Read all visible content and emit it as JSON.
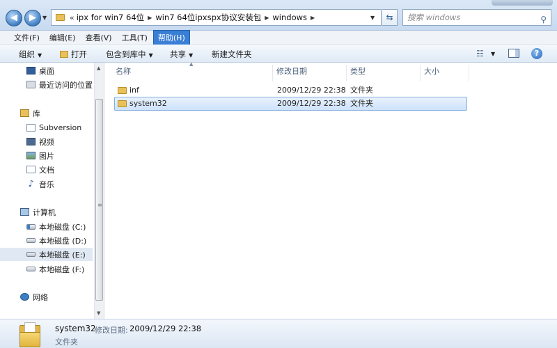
{
  "address": {
    "breadcrumbs": [
      "ipx for win7 64位",
      "win7 64位ipxspx协议安装包",
      "windows"
    ],
    "prefix": "«",
    "search_placeholder": "搜索 windows"
  },
  "menu": {
    "items": [
      "文件(F)",
      "编辑(E)",
      "查看(V)",
      "工具(T)",
      "帮助(H)"
    ],
    "active_index": 4
  },
  "toolbar": {
    "organize": "组织",
    "open": "打开",
    "include_in_library": "包含到库中",
    "share": "共享",
    "new_folder": "新建文件夹"
  },
  "nav": {
    "favorites": [
      {
        "label": "桌面",
        "icon": "desktop-icon"
      },
      {
        "label": "最近访问的位置",
        "icon": "recent-places-icon"
      }
    ],
    "libraries_label": "库",
    "libraries": [
      {
        "label": "Subversion",
        "icon": "document-library-icon"
      },
      {
        "label": "视频",
        "icon": "video-icon"
      },
      {
        "label": "图片",
        "icon": "picture-icon"
      },
      {
        "label": "文档",
        "icon": "document-icon"
      },
      {
        "label": "音乐",
        "icon": "music-icon"
      }
    ],
    "computer_label": "计算机",
    "drives": [
      {
        "label": "本地磁盘 (C:)",
        "icon": "system-drive-icon"
      },
      {
        "label": "本地磁盘 (D:)",
        "icon": "drive-icon"
      },
      {
        "label": "本地磁盘 (E:)",
        "icon": "drive-icon"
      },
      {
        "label": "本地磁盘 (F:)",
        "icon": "drive-icon"
      }
    ],
    "selected_drive_index": 2,
    "network_label": "网络"
  },
  "columns": {
    "name": "名称",
    "modified": "修改日期",
    "type": "类型",
    "size": "大小"
  },
  "files": [
    {
      "name": "inf",
      "modified": "2009/12/29 22:38",
      "type": "文件夹",
      "size": ""
    },
    {
      "name": "system32",
      "modified": "2009/12/29 22:38",
      "type": "文件夹",
      "size": ""
    }
  ],
  "selected_file_index": 1,
  "details": {
    "name": "system32",
    "modified_label": "修改日期:",
    "modified": "2009/12/29 22:38",
    "type": "文件夹"
  }
}
